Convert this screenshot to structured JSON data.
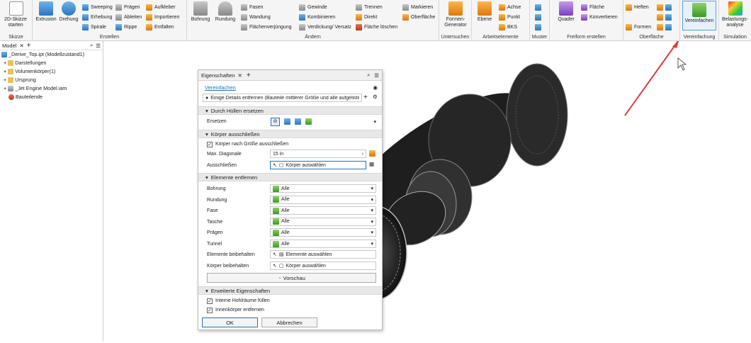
{
  "ribbon": {
    "skizze": {
      "btn": "2D-Skizze starten",
      "label": "Skizze"
    },
    "erstellen": {
      "label": "Erstellen",
      "extrusion": "Extrusion",
      "drehung": "Drehung",
      "sweeping": "Sweeping",
      "erhebung": "Erhebung",
      "spirale": "Spirale",
      "praegen": "Prägen",
      "ableiten": "Ableiten",
      "rippe": "Rippe",
      "aufkleber": "Aufkleber",
      "importieren": "Importieren",
      "entfalten": "Entfalten"
    },
    "aendern": {
      "label": "Ändern",
      "bohrung": "Bohrung",
      "rundung": "Rundung",
      "fasen": "Fasen",
      "wandung": "Wandung",
      "flaechenverj": "Flächenverjüngung",
      "gewinde": "Gewinde",
      "kombinieren": "Kombinieren",
      "verdickung": "Verdickung/ Versatz",
      "trennen": "Trennen",
      "direkt": "Direkt",
      "flaeche_loeschen": "Fläche löschen",
      "markieren": "Markieren",
      "oberflaeche": "Oberfläche"
    },
    "untersuchen": {
      "label": "Untersuchen",
      "formengen": "Formen-Generator"
    },
    "arbeitselemente": {
      "label": "Arbeitselemente",
      "ebene": "Ebene",
      "achse": "Achse",
      "punkt": "Punkt",
      "bks": "BKS"
    },
    "muster": {
      "label": "Muster"
    },
    "freiform": {
      "label": "Freiform erstellen",
      "quader": "Quader",
      "flaeche": "Fläche",
      "konvertieren": "Konvertieren"
    },
    "oberflaeche": {
      "label": "Oberfläche",
      "heften": "Heften",
      "formen": "Formen"
    },
    "vereinfachung": {
      "label": "Vereinfachung",
      "btn": "Vereinfachen"
    },
    "simulation": {
      "label": "Simulation",
      "btn": "Belastungs-analyse"
    }
  },
  "browser": {
    "tab": "Model",
    "items": [
      "_Derive_Top.ipt (Modellzustand1)",
      "Darstellungen",
      "Volumenkörper(1)",
      "Ursprung",
      "_Jet Engine Model.iam",
      "Bauteilende"
    ]
  },
  "panel": {
    "tab": "Eigenschaften",
    "link": "Vereinfachen",
    "preset": "Einige Details entfernen (Bauteile mittlerer Größe und alle aufgeliste",
    "sec1": "Durch Hüllen ersetzen",
    "ersetzen": "Ersetzen",
    "sec2": "Körper ausschließen",
    "cb_groesse": "Körper nach Größe ausschließen",
    "maxdiag_lbl": "Max. Diagonale",
    "maxdiag_val": "15 in",
    "ausschl_lbl": "Ausschließen",
    "koerper_ausw": "Körper auswählen",
    "sec3": "Elemente entfernen",
    "elements": [
      {
        "label": "Bohrung",
        "value": "Alle"
      },
      {
        "label": "Rundung",
        "value": "Alle"
      },
      {
        "label": "Fase",
        "value": "Alle"
      },
      {
        "label": "Tasche",
        "value": "Alle"
      },
      {
        "label": "Prägen",
        "value": "Alle"
      },
      {
        "label": "Tunnel",
        "value": "Alle"
      }
    ],
    "elem_beib_lbl": "Elemente beibehalten",
    "elem_ausw": "Elemente auswählen",
    "koerp_beib_lbl": "Körper beibehalten",
    "koerp_ausw": "Körper auswählen",
    "vorschau": "Vorschau",
    "sec4": "Erweiterte Eigenschaften",
    "cb_hohl": "Interne Hohlräume füllen",
    "cb_innen": "Innenkörper entfernen",
    "ok": "OK",
    "abbrechen": "Abbrechen"
  },
  "colors": {
    "accent": "#1e73be",
    "arrow": "#e03a3a"
  }
}
